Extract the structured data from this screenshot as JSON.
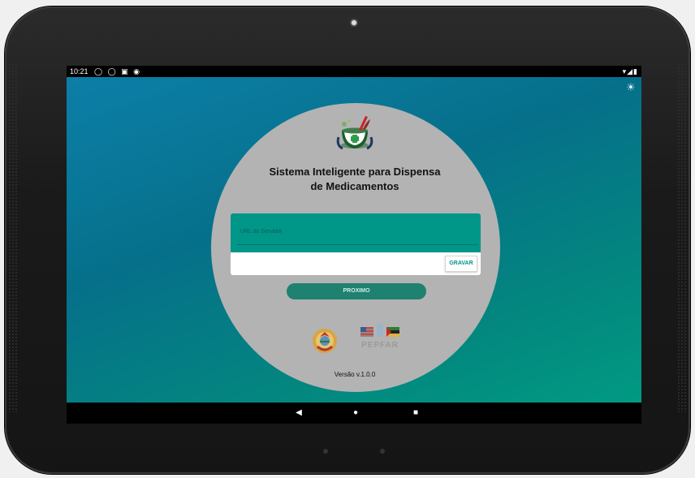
{
  "status_bar": {
    "time": "10:21",
    "left_icons": "◯ ◯ ▣ ◉",
    "right_icons": "▾◢▮"
  },
  "app": {
    "theme_icon": "☀",
    "title_line1": "Sistema Inteligente para Dispensa",
    "title_line2": "de Medicamentos",
    "url_field": {
      "placeholder": "URL do Servidor",
      "value": ""
    },
    "gravar_label": "GRAVAR",
    "proximo_label": "PROXIMO",
    "pepfar_label": "PEPFAR",
    "version": "Versão v.1.0.0"
  },
  "nav_bar": {
    "back": "◀",
    "home": "●",
    "recents": "■"
  },
  "colors": {
    "accent": "#009688",
    "button": "#1f8170",
    "circle": "#b3b3b3",
    "bg_start": "#0c7fa8",
    "bg_end": "#019a82"
  }
}
